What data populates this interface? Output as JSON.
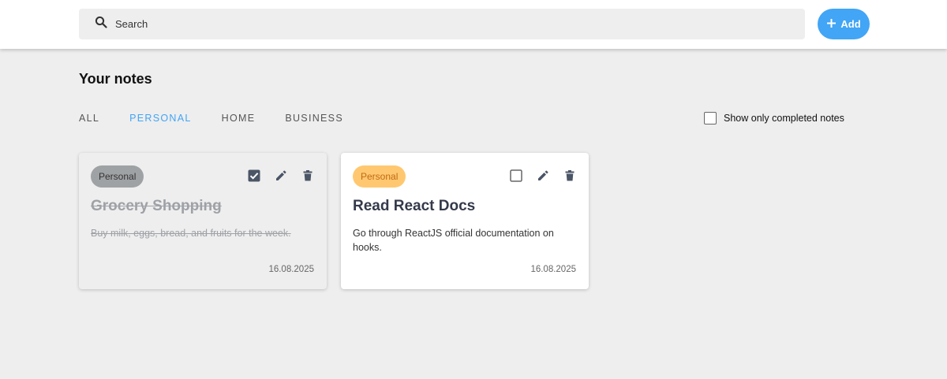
{
  "search": {
    "placeholder": "Search",
    "icon": "search-icon"
  },
  "add_button": {
    "label": "Add",
    "icon": "plus-icon",
    "color": "#42a5f5"
  },
  "heading": "Your notes",
  "tabs": [
    {
      "label": "ALL",
      "active": false
    },
    {
      "label": "PERSONAL",
      "active": true
    },
    {
      "label": "HOME",
      "active": false
    },
    {
      "label": "BUSINESS",
      "active": false
    }
  ],
  "filter": {
    "label": "Show only completed notes",
    "checked": false
  },
  "notes": [
    {
      "category": "Personal",
      "title": "Grocery Shopping",
      "description": "Buy milk, eggs, bread, and fruits for the week.",
      "date": "16.08.2025",
      "completed": true,
      "badge_color": "#9fa2a5"
    },
    {
      "category": "Personal",
      "title": "Read React Docs",
      "description": "Go through ReactJS official documentation on hooks.",
      "date": "16.08.2025",
      "completed": false,
      "badge_color": "#ffc870"
    }
  ]
}
